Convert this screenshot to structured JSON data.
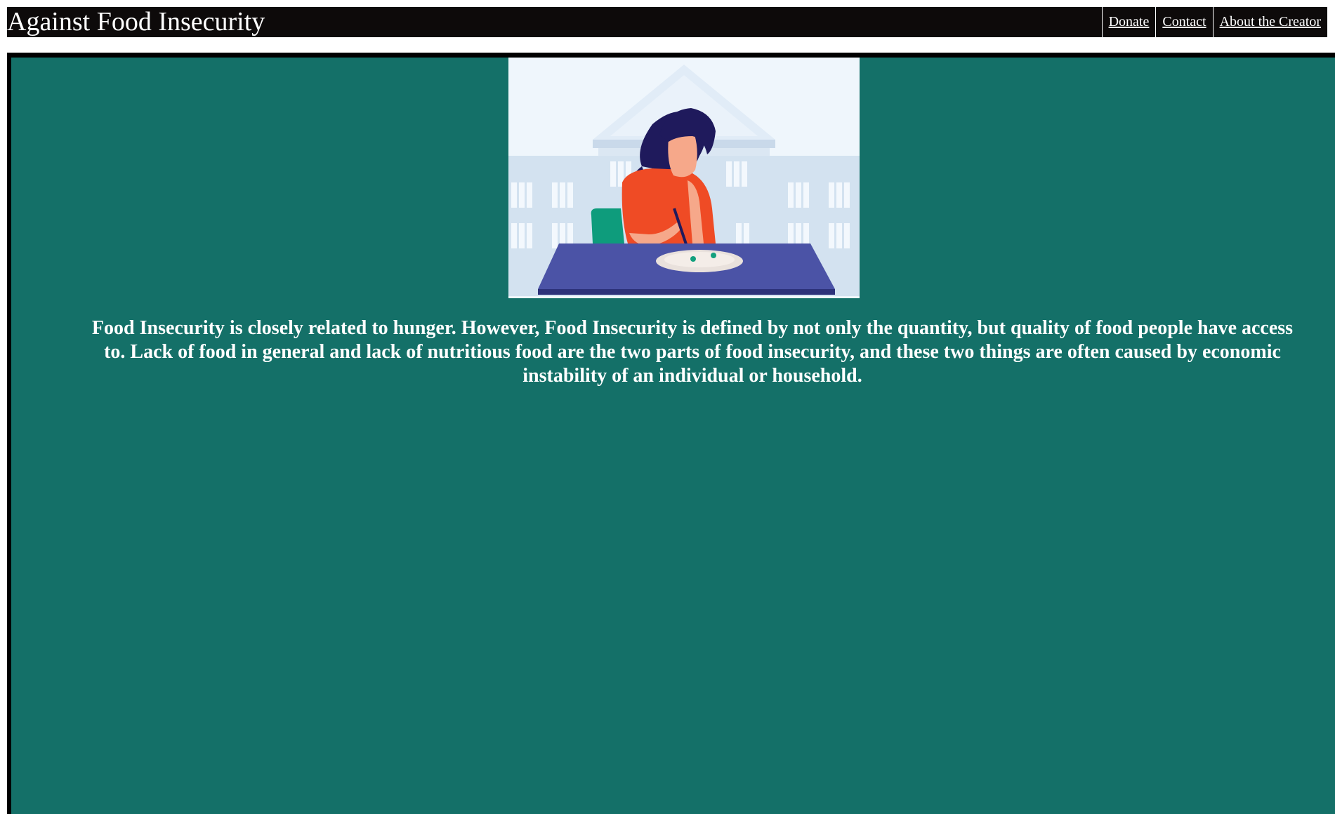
{
  "header": {
    "title": "Against Food Insecurity",
    "nav": [
      {
        "label": "Donate"
      },
      {
        "label": "Contact"
      },
      {
        "label": "About the Creator"
      }
    ]
  },
  "main": {
    "illustration": "woman-eating-alone-illustration",
    "paragraph": "Food Insecurity is closely related to hunger. However, Food Insecurity is defined by not only the quantity, but quality of food people have access to. Lack of food in general and lack of nutritious food are the two parts of food insecurity, and these two things are often caused by economic instability of an individual or household."
  },
  "colors": {
    "header_bg": "#0d0a0a",
    "main_bg": "#147068",
    "text": "#ffffff"
  }
}
